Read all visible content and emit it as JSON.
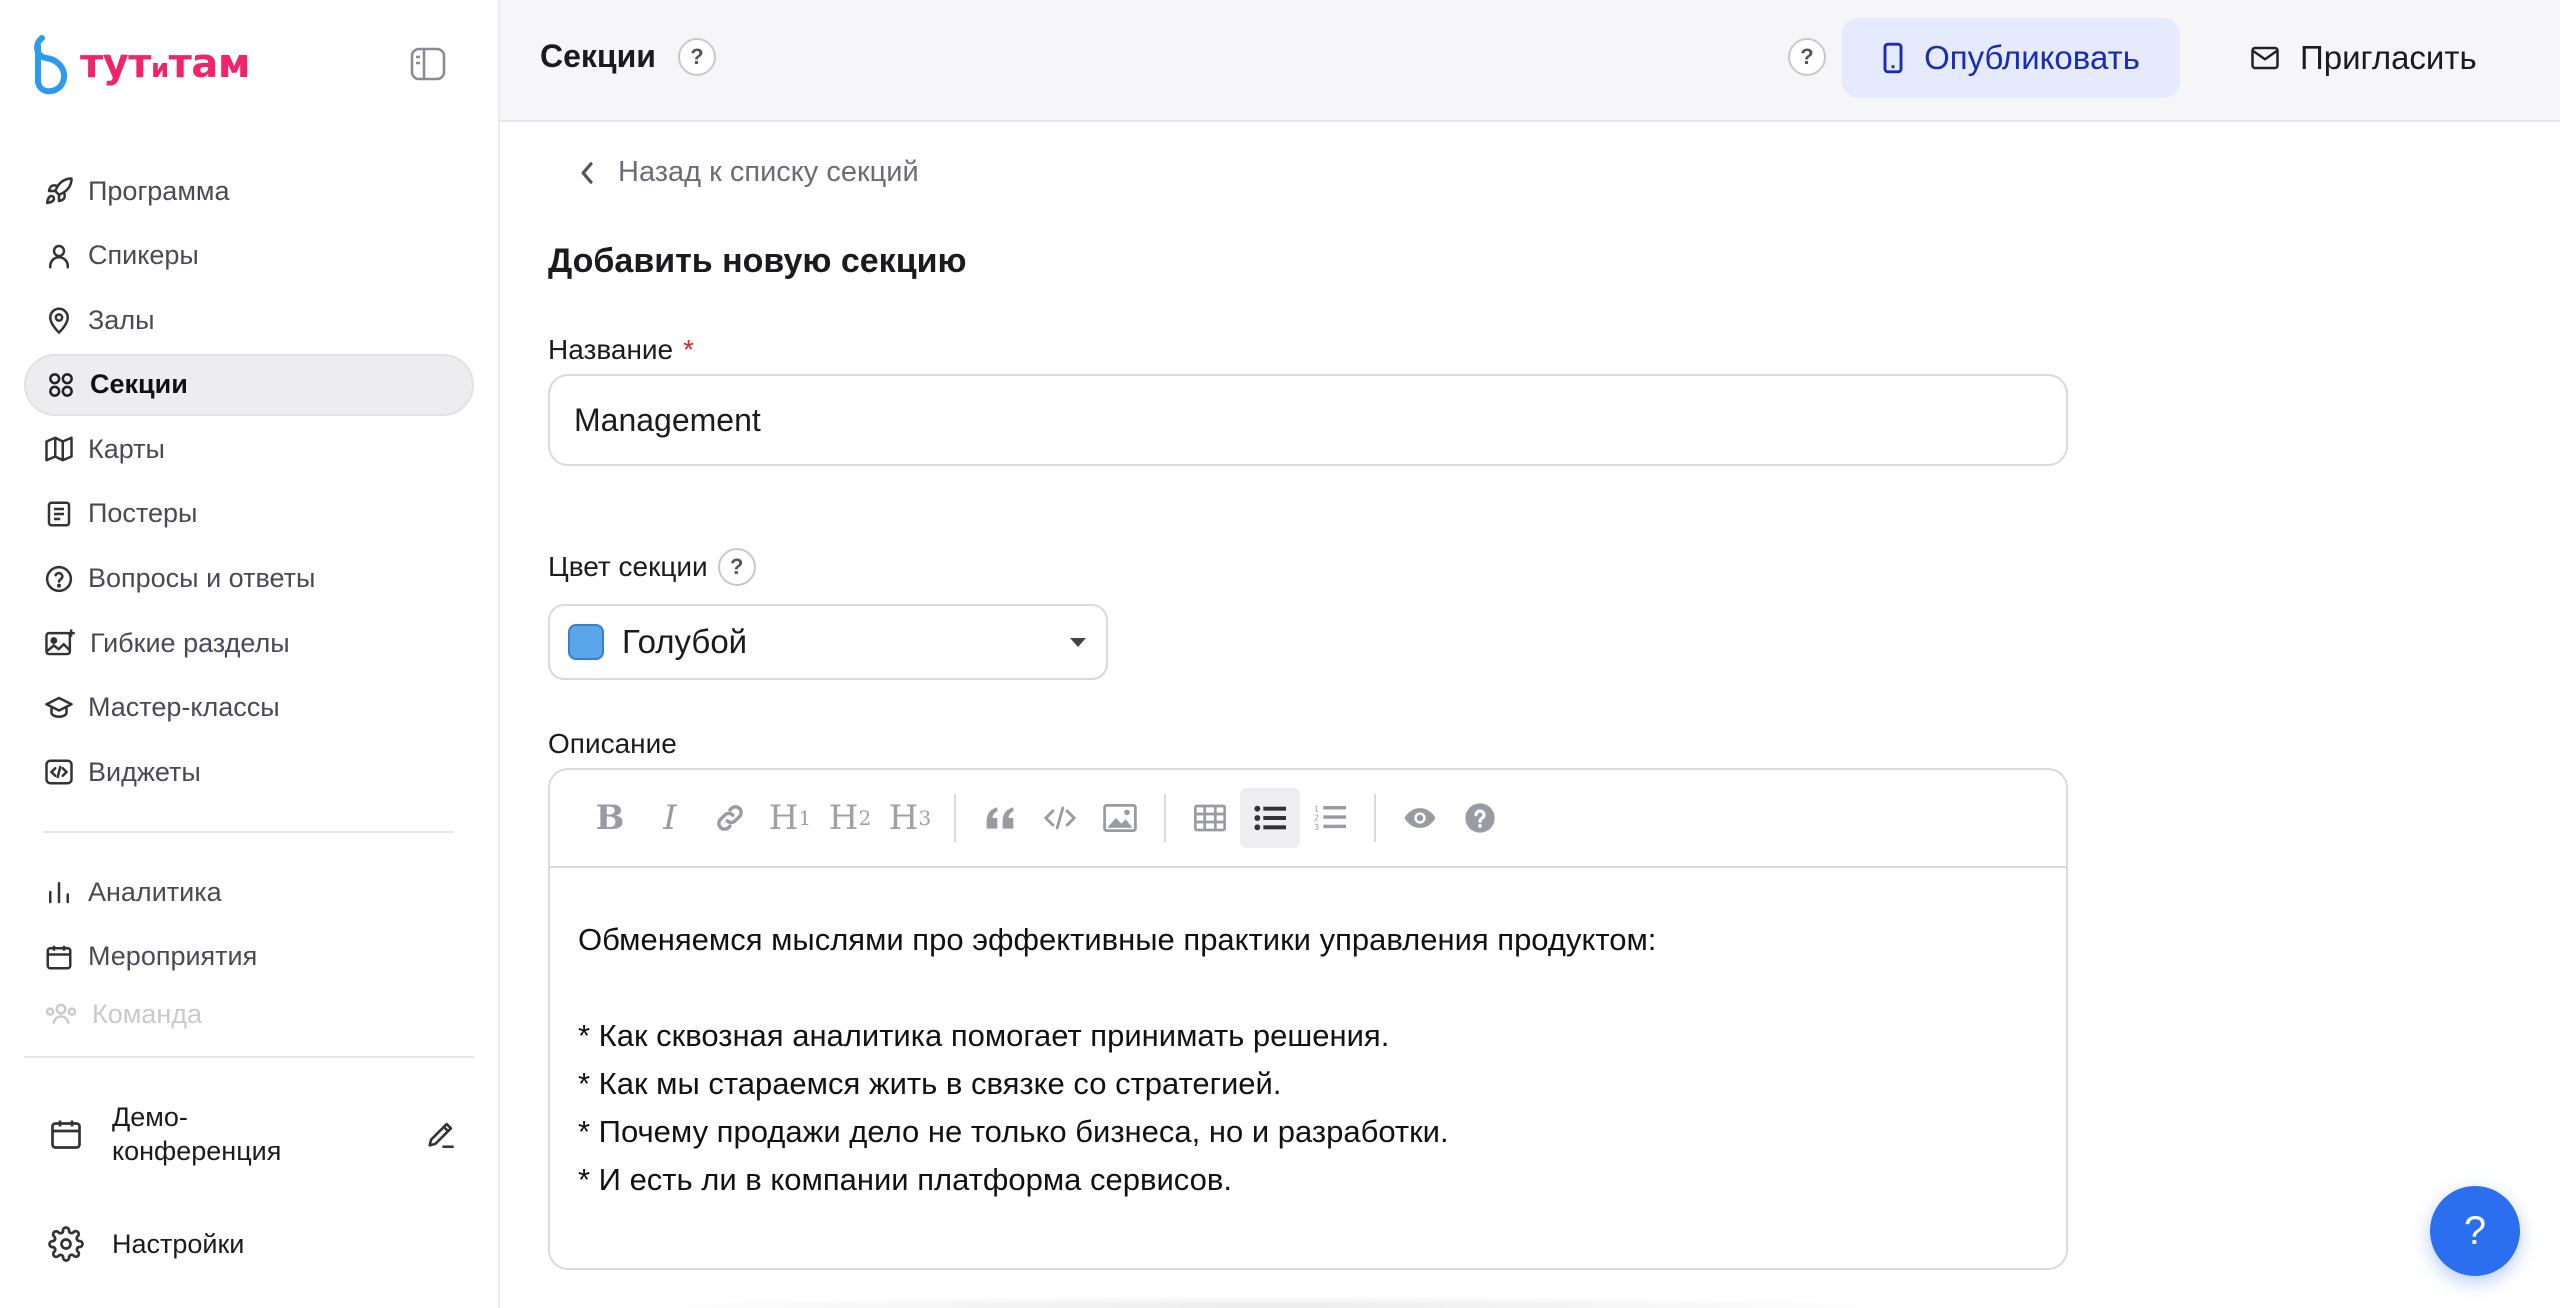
{
  "app": {
    "logo_text_1": "тут",
    "logo_text_2": "и",
    "logo_text_3": "там",
    "brand_color": "#f0246b",
    "accent_color": "#2b6ff0"
  },
  "sidebar": {
    "items": [
      {
        "label": "Программа",
        "icon": "rocket-icon"
      },
      {
        "label": "Спикеры",
        "icon": "user-icon"
      },
      {
        "label": "Залы",
        "icon": "map-pin-icon"
      },
      {
        "label": "Секции",
        "icon": "grid-icon",
        "active": true
      },
      {
        "label": "Карты",
        "icon": "map-icon"
      },
      {
        "label": "Постеры",
        "icon": "poster-icon"
      },
      {
        "label": "Вопросы и ответы",
        "icon": "question-circle-icon"
      },
      {
        "label": "Гибкие разделы",
        "icon": "image-plus-icon"
      },
      {
        "label": "Мастер-классы",
        "icon": "graduation-cap-icon"
      },
      {
        "label": "Виджеты",
        "icon": "code-icon"
      }
    ],
    "secondary_items": [
      {
        "label": "Аналитика",
        "icon": "bar-chart-icon"
      },
      {
        "label": "Мероприятия",
        "icon": "calendar-icon"
      },
      {
        "label": "Команда",
        "icon": "team-icon"
      }
    ],
    "event_name": "Демо-конференция",
    "settings_label": "Настройки"
  },
  "header": {
    "title": "Секции",
    "help": "?",
    "publish_label": "Опубликовать",
    "invite_label": "Пригласить"
  },
  "main": {
    "back_label": "Назад к списку секций",
    "page_title": "Добавить новую секцию",
    "name_label": "Название",
    "required_mark": "*",
    "name_value": "Management",
    "color_label": "Цвет секции",
    "color_value": "Голубой",
    "color_swatch": "#5aa5ea",
    "description_label": "Описание",
    "description_text": "Обменяемся мыслями про эффективные практики управления продуктом:\n\n* Как сквозная аналитика помогает принимать решения.\n* Как мы стараемся жить в связке со стратегией.\n* Почему продажи дело не только бизнеса, но и разработки.\n* И есть ли в компании платформа сервисов.",
    "toolbar": [
      "bold",
      "italic",
      "link",
      "heading-1",
      "heading-2",
      "heading-3",
      "quote",
      "code",
      "image",
      "table",
      "bullet-list",
      "numbered-list",
      "preview",
      "help"
    ]
  },
  "fab": {
    "label": "?"
  }
}
